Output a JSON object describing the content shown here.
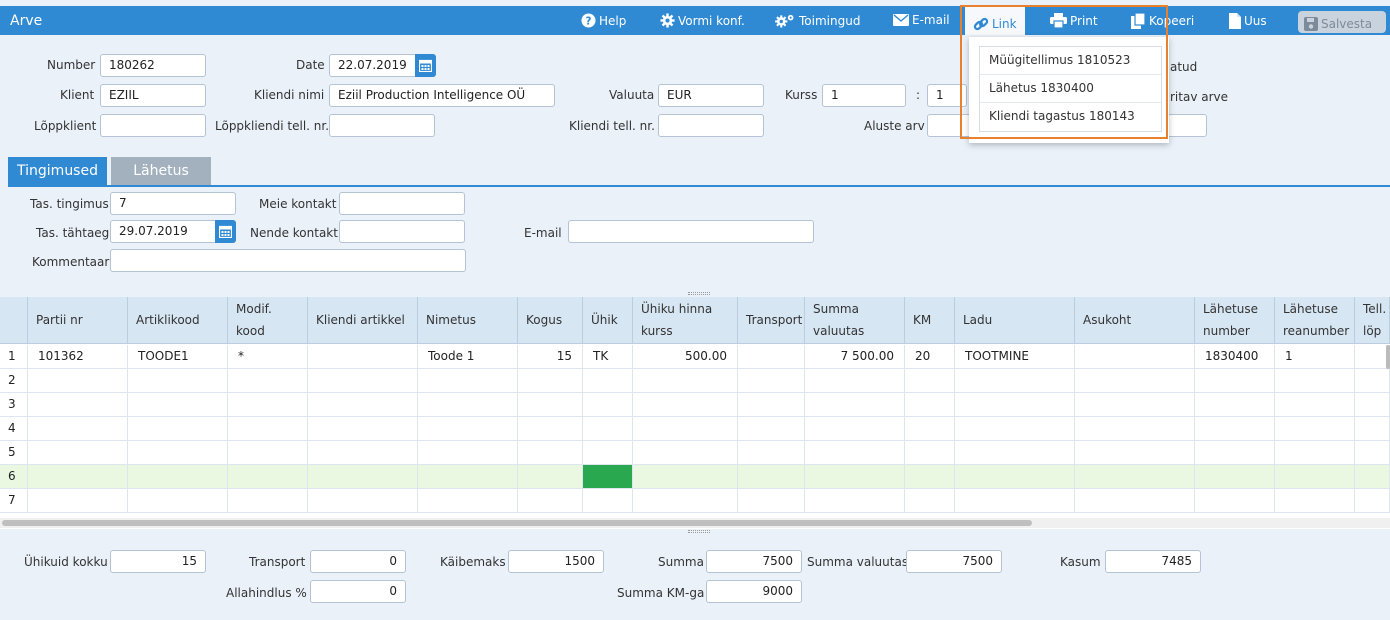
{
  "app": {
    "title": "Arve"
  },
  "toolbar": {
    "help": "Help",
    "form_config": "Vormi konf.",
    "actions": "Toimingud",
    "email": "E-mail",
    "link": "Link",
    "print": "Print",
    "copy": "Kopeeri",
    "new": "Uus",
    "save": "Salvesta"
  },
  "link_menu": {
    "items": [
      "Müügitellimus 1810523",
      "Lähetus 1830400",
      "Kliendi tagastus 180143"
    ]
  },
  "header_form": {
    "number_label": "Number",
    "number": "180262",
    "date_label": "Date",
    "date": "22.07.2019",
    "client_label": "Klient",
    "client": "EZIIL",
    "client_name_label": "Kliendi nimi",
    "client_name": "Eziil Production Intelligence OÜ",
    "currency_label": "Valuuta",
    "currency": "EUR",
    "rate_label": "Kurss",
    "rate": "1",
    "rate_sep": ":",
    "rate2": "1",
    "end_client_label": "Lõppklient",
    "end_client": "",
    "end_client_order_label": "Lõppkliendi tell. nr.",
    "end_client_order": "",
    "client_order_label": "Kliendi tell. nr.",
    "client_order": "",
    "base_invoice_label": "Aluste arv",
    "base_invoice": "",
    "partial_label_1": "atud",
    "partial_label_2": "ritav arve"
  },
  "tabs": [
    {
      "label": "Tingimused",
      "active": true
    },
    {
      "label": "Lähetus",
      "active": false
    }
  ],
  "terms": {
    "payment_terms_label": "Tas. tingimus",
    "payment_terms": "7",
    "our_contact_label": "Meie kontakt",
    "our_contact": "",
    "due_date_label": "Tas. tähtaeg",
    "due_date": "29.07.2019",
    "their_contact_label": "Nende kontakt",
    "their_contact": "",
    "email_label": "E-mail",
    "email": "",
    "comment_label": "Kommentaar",
    "comment": ""
  },
  "grid": {
    "headers": [
      "Partii nr",
      "Artiklikood",
      "Modif. kood",
      "Kliendi artikkel",
      "Nimetus",
      "Kogus",
      "Ühik",
      "Ühiku hinna kurss",
      "Transport",
      "Summa valuutas",
      "KM",
      "Ladu",
      "Asukoht",
      "Lähetuse number",
      "Lähetuse reanumber",
      "Tell. löp"
    ],
    "row_numbers": [
      "1",
      "2",
      "3",
      "4",
      "5",
      "6",
      "7"
    ],
    "rows": [
      [
        "101362",
        "TOODE1",
        "*",
        "",
        "Toode 1",
        "15",
        "TK",
        "500.00",
        "",
        "7 500.00",
        "20",
        "TOOTMINE",
        "",
        "1830400",
        "1",
        ""
      ]
    ]
  },
  "totals": {
    "units_total_label": "Ühikuid kokku",
    "units_total": "15",
    "transport_label": "Transport",
    "transport": "0",
    "vat_label": "Käibemaks",
    "vat": "1500",
    "sum_label": "Summa",
    "sum": "7500",
    "sum_currency_label": "Summa valuutas",
    "sum_currency": "7500",
    "profit_label": "Kasum",
    "profit": "7485",
    "discount_label": "Allahindlus %",
    "discount": "0",
    "sum_vat_label": "Summa KM-ga",
    "sum_vat": "9000"
  },
  "colors": {
    "accent": "#2f8ad3",
    "highlight": "#e8802e",
    "selected_cell": "#2aa84f",
    "active_row": "#eaf7e1"
  }
}
